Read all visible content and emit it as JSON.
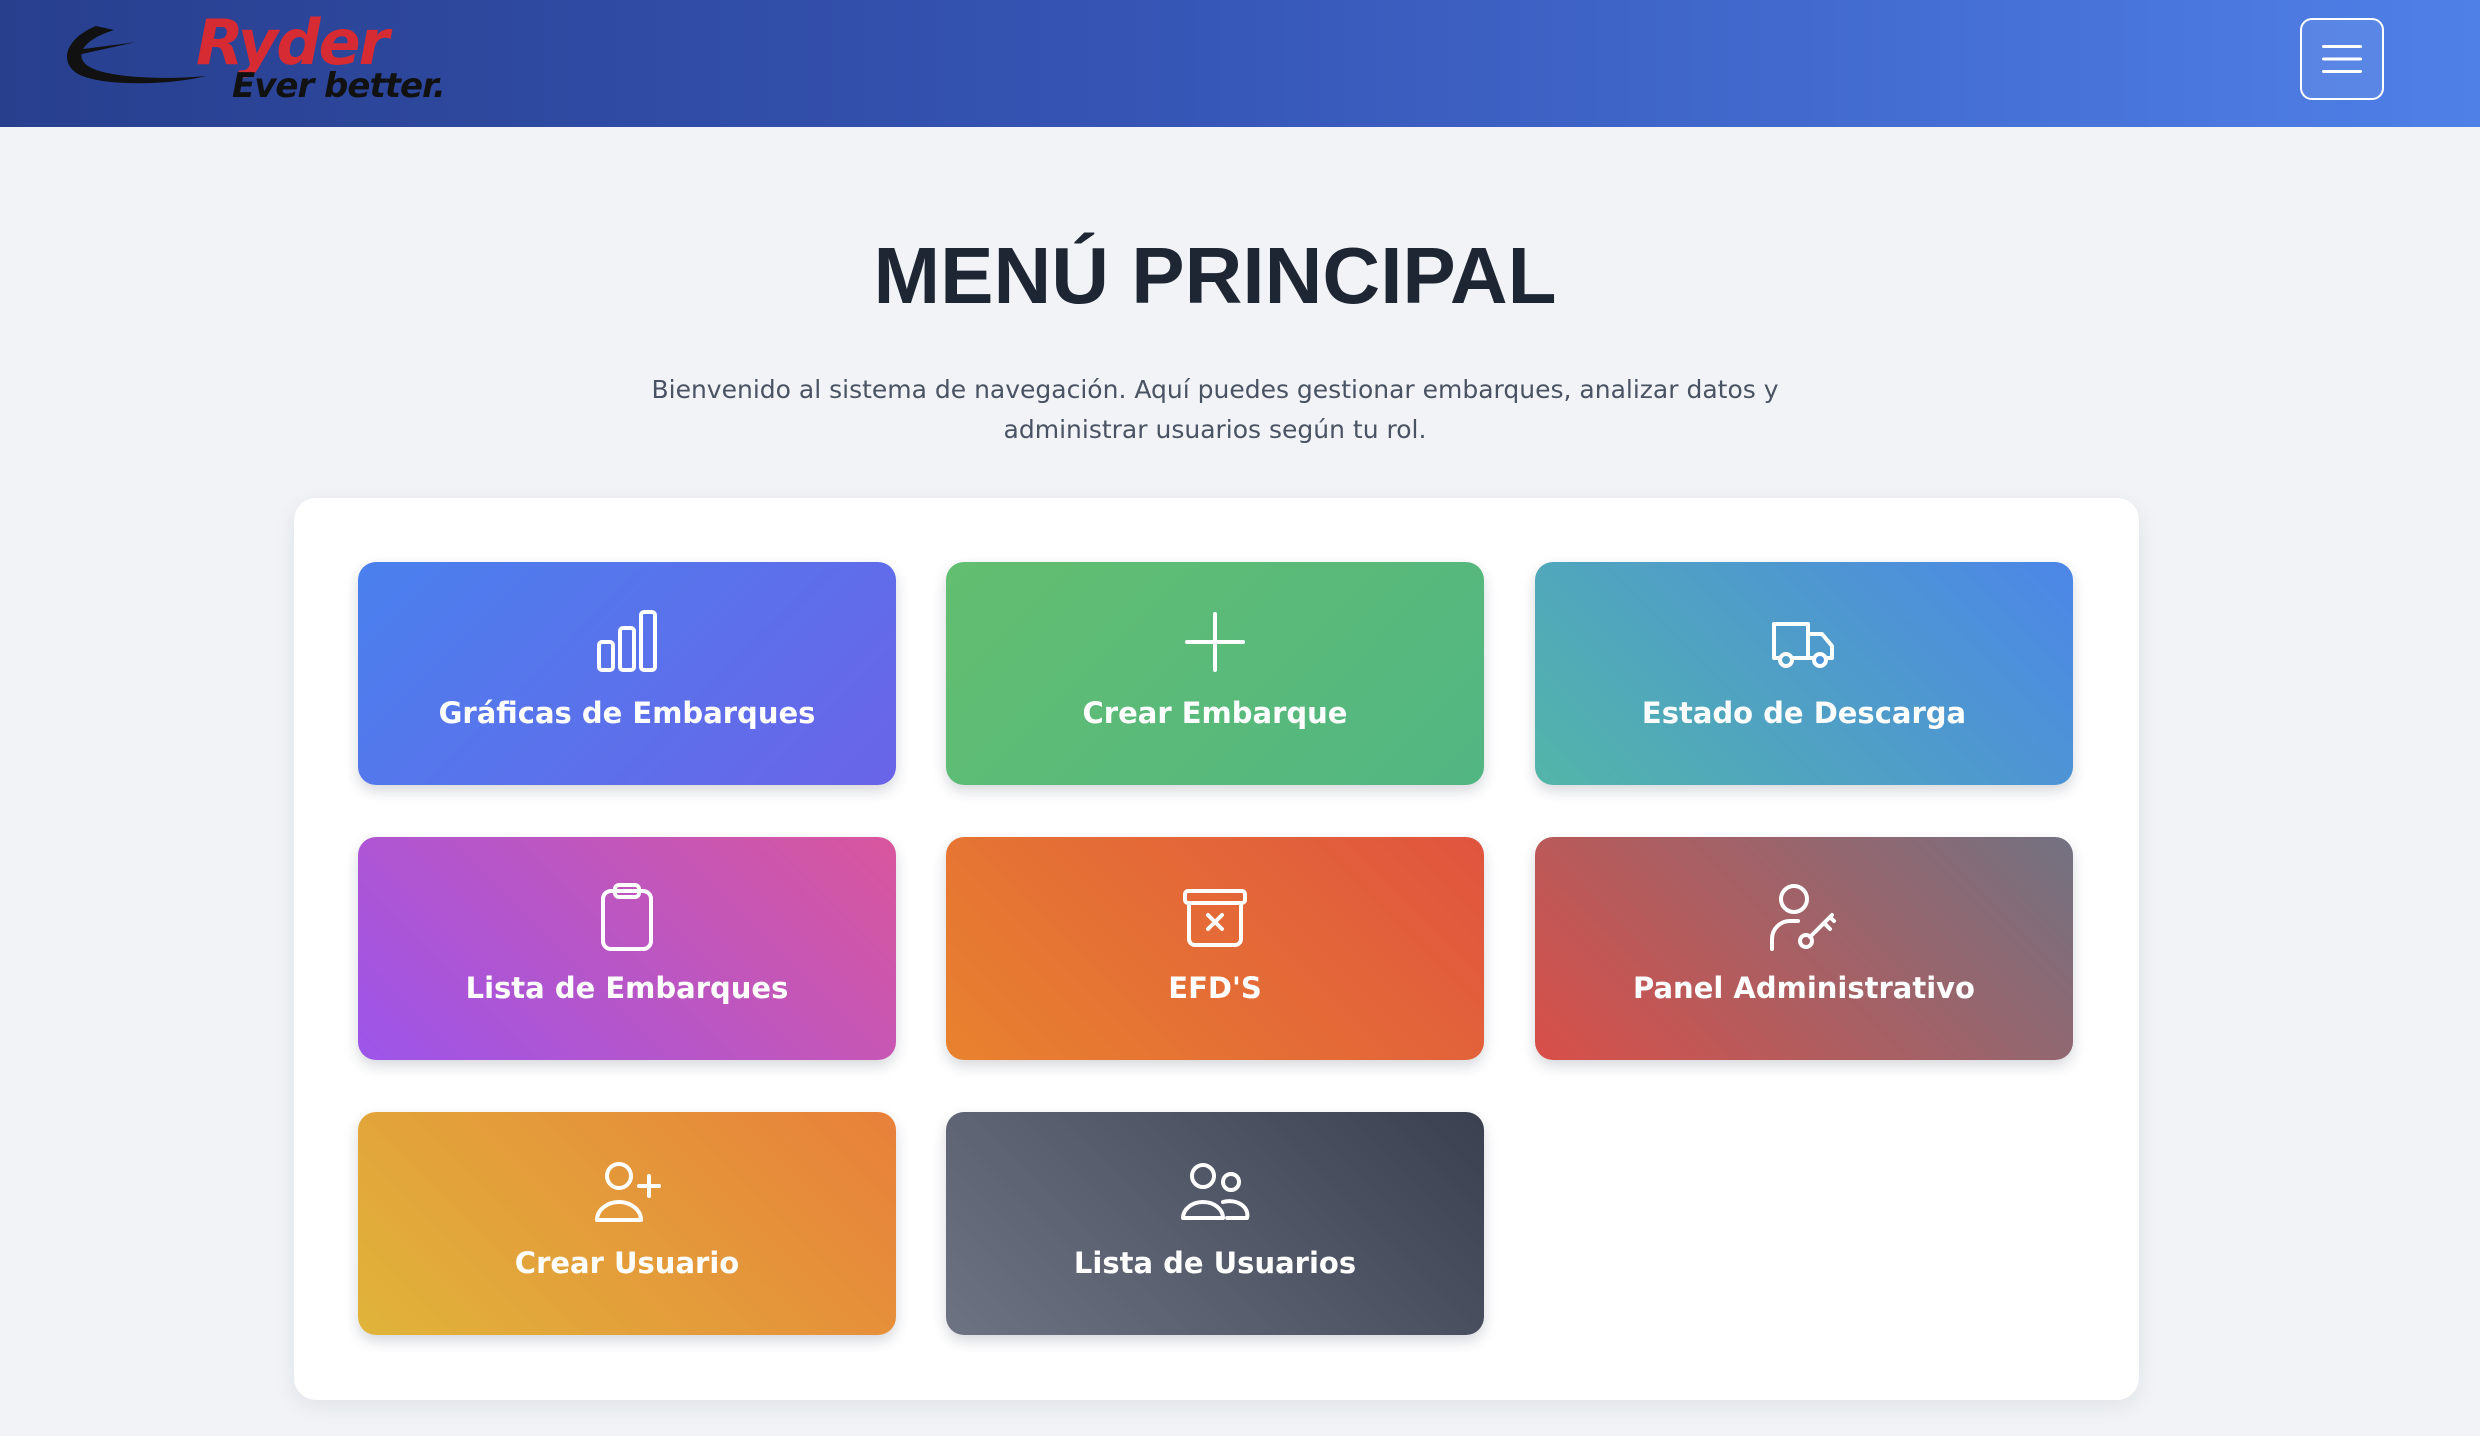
{
  "header": {
    "logo": {
      "brand": "Ryder",
      "tagline": "Ever better."
    },
    "menu_icon": "hamburger-menu-icon"
  },
  "main": {
    "title": "MENÚ PRINCIPAL",
    "intro": "Bienvenido al sistema de navegación. Aquí puedes gestionar embarques, analizar datos y administrar usuarios según tu rol."
  },
  "cards": [
    {
      "label": "Gráficas de Embarques",
      "icon": "bar-chart-icon",
      "colors": [
        "#4a80ee",
        "#6a64e8"
      ]
    },
    {
      "label": "Crear Embarque",
      "icon": "plus-icon",
      "colors": [
        "#62be6f",
        "#52b683"
      ]
    },
    {
      "label": "Estado de Descarga",
      "icon": "truck-icon",
      "colors": [
        "#52b5a8",
        "#4c86e8"
      ]
    },
    {
      "label": "Lista de Embarques",
      "icon": "clipboard-icon",
      "colors": [
        "#9c55ea",
        "#d9569d"
      ]
    },
    {
      "label": "EFD'S",
      "icon": "archive-x-icon",
      "colors": [
        "#e8822e",
        "#e0543f"
      ]
    },
    {
      "label": "Panel Administrativo",
      "icon": "user-key-icon",
      "colors": [
        "#d94f48",
        "#727282"
      ]
    },
    {
      "label": "Crear Usuario",
      "icon": "user-plus-icon",
      "colors": [
        "#e0b43a",
        "#e8803a"
      ]
    },
    {
      "label": "Lista de Usuarios",
      "icon": "users-icon",
      "colors": [
        "#6d7382",
        "#3a4050"
      ]
    }
  ]
}
